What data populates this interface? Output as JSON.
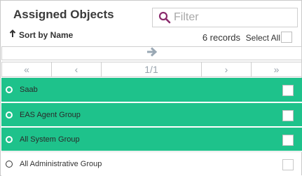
{
  "header": {
    "title": "Assigned Objects",
    "filter_placeholder": "Filter",
    "sort_label": "Sort by Name",
    "records_count": "6 records",
    "select_all_label": "Select All"
  },
  "pager": {
    "first": "«",
    "prev": "‹",
    "page_info": "1/1",
    "next": "›",
    "last": "»"
  },
  "rows": [
    {
      "label": "Saab",
      "selected": true
    },
    {
      "label": "EAS Agent Group",
      "selected": true
    },
    {
      "label": "All System Group",
      "selected": true
    },
    {
      "label": "All Administrative Group",
      "selected": false
    }
  ],
  "colors": {
    "selected_row": "#1ec28b",
    "search_icon": "#8b2c6d",
    "move_arrow": "#9aa8b4"
  }
}
